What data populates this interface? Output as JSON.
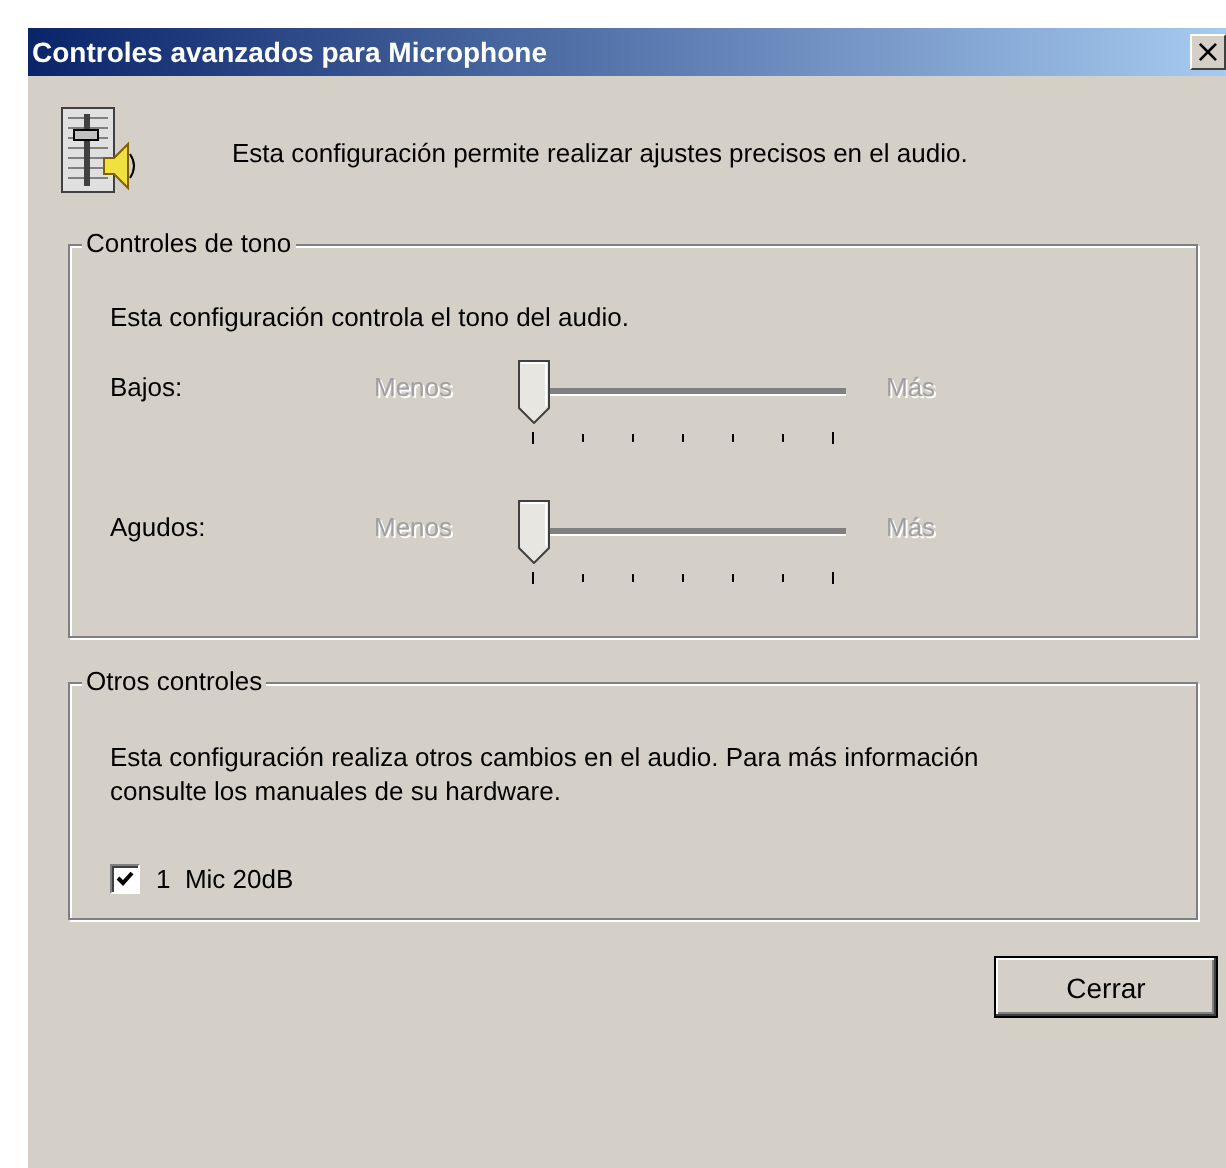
{
  "window": {
    "title": "Controles avanzados para Microphone",
    "close": "×"
  },
  "intro": "Esta configuración permite realizar ajustes precisos en el audio.",
  "tone_group": {
    "legend": "Controles de tono",
    "description": "Esta configuración controla el tono del audio.",
    "sliders": [
      {
        "label": "Bajos:",
        "min_label": "Menos",
        "max_label": "Más",
        "level": 0,
        "disabled": true
      },
      {
        "label": "Agudos:",
        "min_label": "Menos",
        "max_label": "Más",
        "level": 0,
        "disabled": true
      }
    ]
  },
  "other_group": {
    "legend": "Otros controles",
    "description": "Esta configuración realiza otros cambios en el audio. Para más información consulte los manuales de su hardware.",
    "checkboxes": [
      {
        "label": "1  Mic 20dB",
        "checked": true
      }
    ]
  },
  "buttons": [
    "Cerrar"
  ]
}
